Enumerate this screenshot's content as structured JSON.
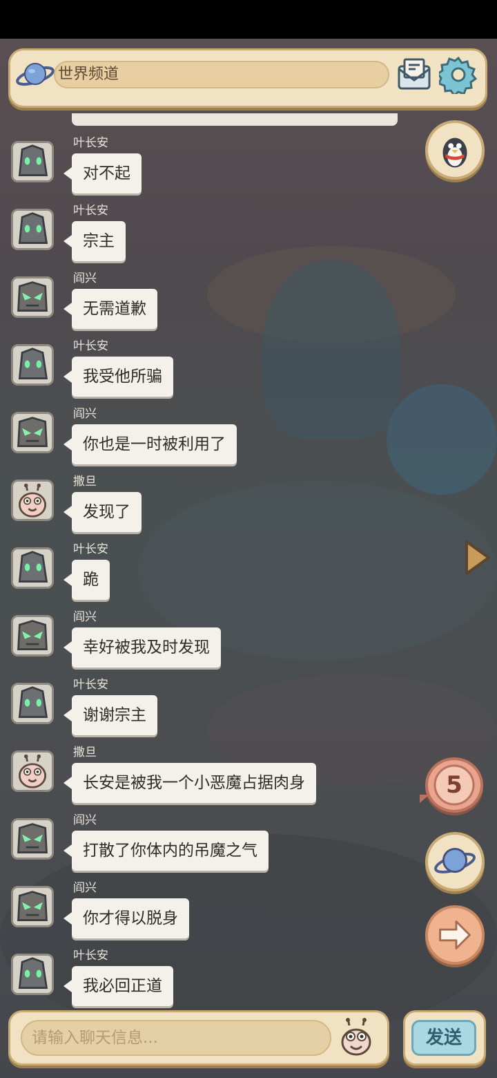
{
  "header": {
    "channel_title": "世界频道",
    "icons": [
      "planet-icon",
      "mail-icon",
      "gear-icon"
    ]
  },
  "messages": [
    {
      "sender": "叶长安",
      "text": "对不起",
      "avatar": "stone-golem"
    },
    {
      "sender": "叶长安",
      "text": "宗主",
      "avatar": "stone-golem"
    },
    {
      "sender": "阎兴",
      "text": "无需道歉",
      "avatar": "angry-golem"
    },
    {
      "sender": "叶长安",
      "text": "我受他所骗",
      "avatar": "stone-golem"
    },
    {
      "sender": "阎兴",
      "text": "你也是一时被利用了",
      "avatar": "angry-golem"
    },
    {
      "sender": "撒旦",
      "text": "发现了",
      "avatar": "snail"
    },
    {
      "sender": "叶长安",
      "text": "跪",
      "avatar": "stone-golem"
    },
    {
      "sender": "阎兴",
      "text": "幸好被我及时发现",
      "avatar": "angry-golem"
    },
    {
      "sender": "叶长安",
      "text": "谢谢宗主",
      "avatar": "stone-golem"
    },
    {
      "sender": "撒旦",
      "text": "长安是被我一个小恶魔占据肉身",
      "avatar": "snail"
    },
    {
      "sender": "阎兴",
      "text": "打散了你体内的吊魔之气",
      "avatar": "angry-golem"
    },
    {
      "sender": "阎兴",
      "text": "你才得以脱身",
      "avatar": "angry-golem"
    },
    {
      "sender": "叶长安",
      "text": "我必回正道",
      "avatar": "stone-golem"
    }
  ],
  "side_buttons": {
    "penguin": "penguin-icon",
    "counter_value": "5",
    "planet": "planet-icon",
    "next": "arrow-right-icon"
  },
  "input": {
    "placeholder": "请输入聊天信息..."
  },
  "send_label": "发送",
  "colors": {
    "panel": "#f0e2c2",
    "panel_border": "#c9ab76",
    "bubble": "#f4f1ea",
    "send": "#a9d8e3",
    "counter": "#e9a58f"
  }
}
